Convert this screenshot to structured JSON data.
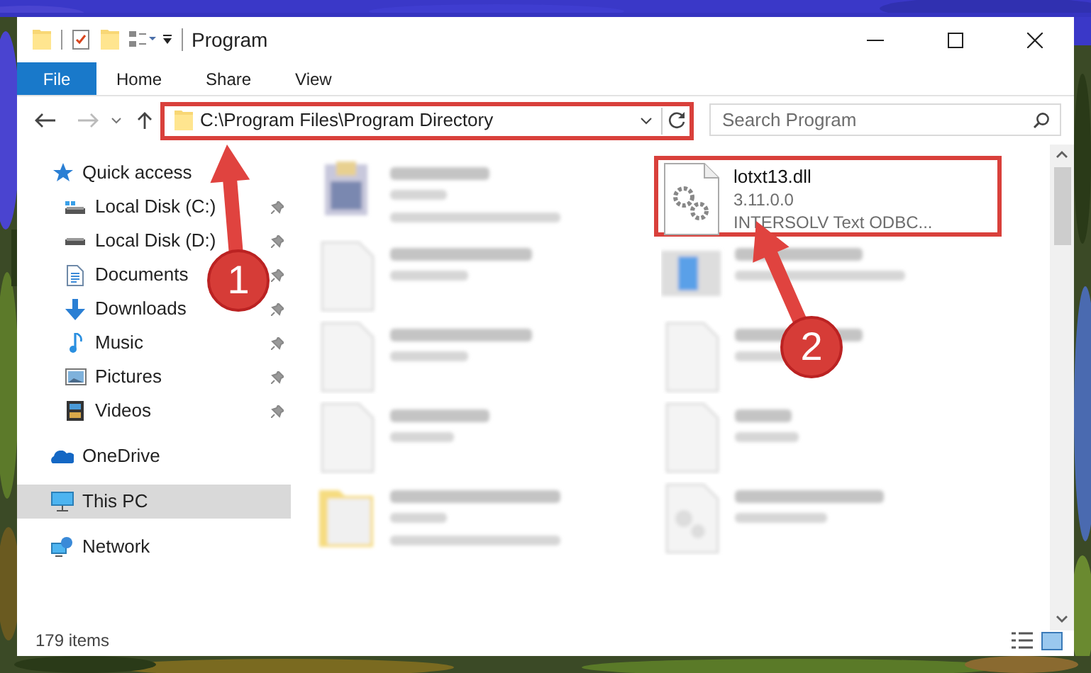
{
  "window": {
    "title": "Program"
  },
  "ribbon_tabs": [
    {
      "label": "File",
      "kind": "file_menu"
    },
    {
      "label": "Home",
      "kind": "tab"
    },
    {
      "label": "Share",
      "kind": "tab"
    },
    {
      "label": "View",
      "kind": "tab"
    }
  ],
  "address_bar": {
    "path": "C:\\Program Files\\Program Directory",
    "highlighted": true
  },
  "search": {
    "placeholder": "Search Program"
  },
  "nav": [
    {
      "label": "Quick access",
      "selected": false,
      "children": [
        {
          "label": "Local Disk (C:)",
          "pinned": true,
          "selected": false
        },
        {
          "label": "Local Disk (D:)",
          "pinned": true,
          "selected": false
        },
        {
          "label": "Documents",
          "pinned": true,
          "selected": false
        },
        {
          "label": "Downloads",
          "pinned": true,
          "selected": false
        },
        {
          "label": "Music",
          "pinned": true,
          "selected": false
        },
        {
          "label": "Pictures",
          "pinned": true,
          "selected": false
        },
        {
          "label": "Videos",
          "pinned": true,
          "selected": false
        }
      ]
    },
    {
      "label": "OneDrive",
      "selected": false
    },
    {
      "label": "This PC",
      "selected": true
    },
    {
      "label": "Network",
      "selected": false
    }
  ],
  "files": [
    {
      "kind": "blurred"
    },
    {
      "kind": "file",
      "name": "lotxt13.dll",
      "details": [
        "3.11.0.0",
        "INTERSOLV Text ODBC..."
      ],
      "highlighted": true
    },
    {
      "kind": "blurred"
    },
    {
      "kind": "blurred"
    },
    {
      "kind": "blurred"
    },
    {
      "kind": "blurred"
    },
    {
      "kind": "blurred"
    },
    {
      "kind": "blurred"
    },
    {
      "kind": "blurred"
    },
    {
      "kind": "blurred"
    }
  ],
  "status_bar": {
    "count": "179 items"
  },
  "annotations": [
    {
      "number": "1"
    },
    {
      "number": "2"
    }
  ]
}
